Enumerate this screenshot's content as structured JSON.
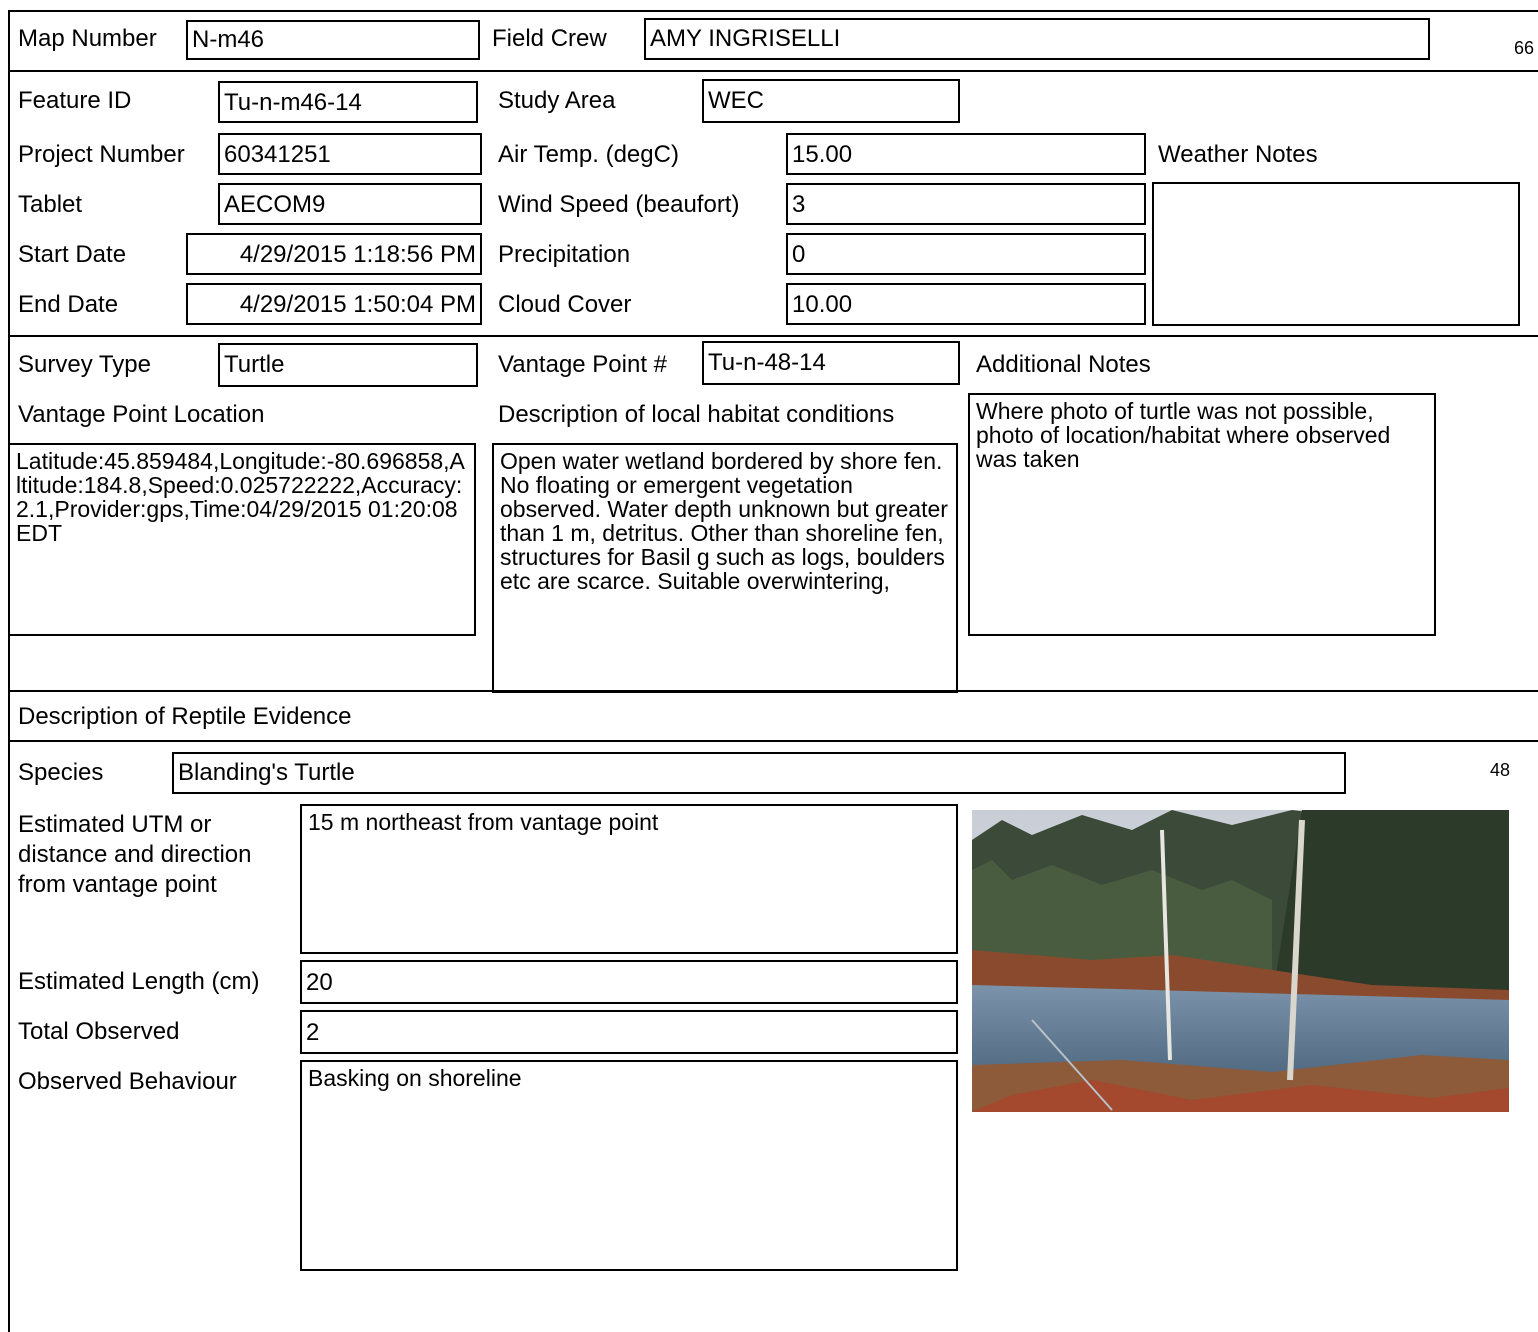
{
  "page_number_top": "66",
  "page_number_mid": "48",
  "header": {
    "map_number_label": "Map Number",
    "map_number": "N-m46",
    "field_crew_label": "Field Crew",
    "field_crew": "AMY INGRISELLI"
  },
  "info": {
    "feature_id_label": "Feature ID",
    "feature_id": "Tu-n-m46-14",
    "study_area_label": "Study Area",
    "study_area": "WEC",
    "project_number_label": "Project Number",
    "project_number": "60341251",
    "air_temp_label": "Air Temp. (degC)",
    "air_temp": "15.00",
    "weather_notes_label": "Weather Notes",
    "weather_notes": "",
    "tablet_label": "Tablet",
    "tablet": "AECOM9",
    "wind_speed_label": "Wind Speed (beaufort)",
    "wind_speed": "3",
    "start_date_label": "Start Date",
    "start_date": "4/29/2015 1:18:56 PM",
    "precipitation_label": "Precipitation",
    "precipitation": "0",
    "end_date_label": "End Date",
    "end_date": "4/29/2015 1:50:04 PM",
    "cloud_cover_label": "Cloud Cover",
    "cloud_cover": "10.00"
  },
  "survey": {
    "survey_type_label": "Survey Type",
    "survey_type": "Turtle",
    "vantage_point_label": "Vantage Point #",
    "vantage_point": "Tu-n-48-14",
    "additional_notes_label": "Additional Notes",
    "additional_notes": "Where photo of turtle was not possible,  photo of location/habitat where observed was taken",
    "vp_location_label": "Vantage Point Location",
    "vp_location": "Latitude:45.859484,Longitude:-80.696858,Altitude:184.8,Speed:0.025722222,Accuracy:2.1,Provider:gps,Time:04/29/2015 01:20:08 EDT",
    "habitat_label": "Description of local habitat conditions",
    "habitat": "Open water wetland bordered by shore fen. No floating or emergent vegetation observed. Water depth unknown but greater than 1 m, detritus.  Other than shoreline fen, structures for Basil g such as logs, boulders etc are scarce.  Suitable overwintering,"
  },
  "evidence": {
    "section_label": "Description of Reptile Evidence",
    "species_label": "Species",
    "species": "Blanding's Turtle",
    "utm_label": "Estimated UTM or distance and direction from vantage point",
    "utm": "15 m northeast from vantage point",
    "length_label": "Estimated Length (cm)",
    "length": "20",
    "total_label": "Total Observed",
    "total": "2",
    "behaviour_label": "Observed Behaviour",
    "behaviour": "Basking on shoreline"
  }
}
